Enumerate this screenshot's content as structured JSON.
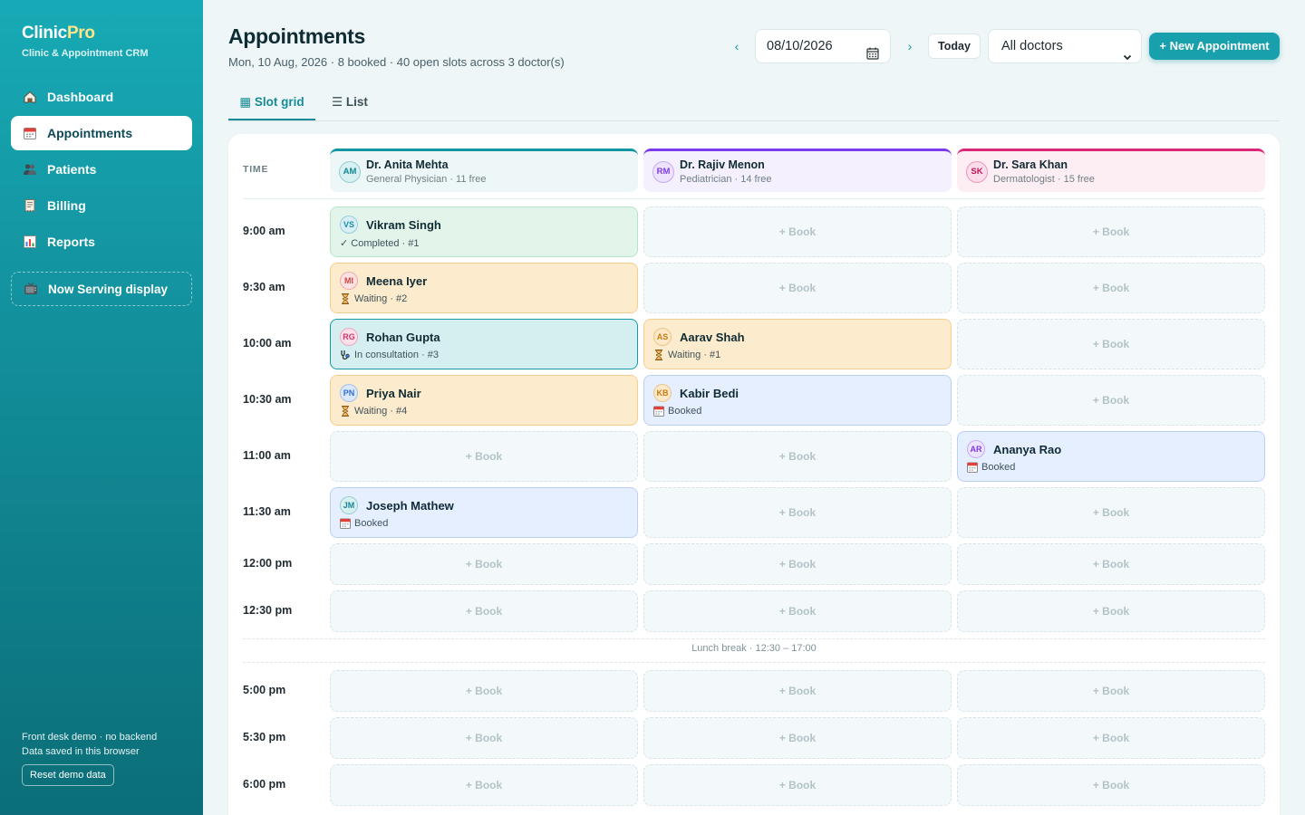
{
  "sidebar": {
    "brand_prefix": "Clinic",
    "brand_suffix": "Pro",
    "brand_sub": "Clinic & Appointment CRM",
    "items": [
      {
        "label": "Dashboard",
        "icon": "home-icon"
      },
      {
        "label": "Appointments",
        "icon": "calendar-icon",
        "active": true
      },
      {
        "label": "Patients",
        "icon": "people-icon"
      },
      {
        "label": "Billing",
        "icon": "receipt-icon"
      },
      {
        "label": "Reports",
        "icon": "bar-chart-icon"
      }
    ],
    "serving": {
      "label": "Now Serving display",
      "icon": "tv-icon"
    },
    "footer_line1": "Front desk demo · no backend",
    "footer_line2": "Data saved in this browser",
    "reset_label": "Reset demo data"
  },
  "header": {
    "title": "Appointments",
    "subtitle": "Mon, 10 Aug, 2026 · 8 booked · 40 open slots across 3 doctor(s)",
    "prev": "‹",
    "next": "›",
    "date_value": "08/10/2026",
    "today_label": "Today",
    "doctor_filter": "All doctors",
    "new_button": "+ New Appointment"
  },
  "tabs": {
    "grid": "▦ Slot grid",
    "list": "☰ List"
  },
  "grid": {
    "time_header": "TIME",
    "doctors": [
      {
        "initials": "AM",
        "name": "Dr. Anita Mehta",
        "sub": "General Physician · 11 free",
        "accent": "#1597a3",
        "bg": "#eef7f8",
        "av_bg": "#d9f0f2",
        "av_fg": "#138794"
      },
      {
        "initials": "RM",
        "name": "Dr. Rajiv Menon",
        "sub": "Pediatrician · 14 free",
        "accent": "#7c3aed",
        "bg": "#f4f0fd",
        "av_bg": "#ede3fd",
        "av_fg": "#7c3aed"
      },
      {
        "initials": "SK",
        "name": "Dr. Sara Khan",
        "sub": "Dermatologist · 15 free",
        "accent": "#db2777",
        "bg": "#fdeef4",
        "av_bg": "#fbdceb",
        "av_fg": "#c2185b"
      }
    ],
    "book_label": "+ Book",
    "rows": [
      {
        "time": "9:00 am",
        "cells": [
          {
            "type": "appt",
            "initials": "VS",
            "name": "Vikram Singh",
            "status": "completed",
            "icon": "check-icon",
            "text": "✓ Completed · #1",
            "av_bg": "#d9eef5",
            "av_fg": "#1b8ca5"
          },
          {
            "type": "empty"
          },
          {
            "type": "empty"
          }
        ]
      },
      {
        "time": "9:30 am",
        "cells": [
          {
            "type": "appt",
            "initials": "MI",
            "name": "Meena Iyer",
            "status": "waiting",
            "icon": "hourglass-icon",
            "text": "Waiting · #2",
            "av_bg": "#fde0e0",
            "av_fg": "#d14545"
          },
          {
            "type": "empty"
          },
          {
            "type": "empty"
          }
        ]
      },
      {
        "time": "10:00 am",
        "cells": [
          {
            "type": "appt",
            "initials": "RG",
            "name": "Rohan Gupta",
            "status": "consult",
            "icon": "stethoscope-icon",
            "text": "In consultation · #3",
            "av_bg": "#fde0ea",
            "av_fg": "#d1346b"
          },
          {
            "type": "appt",
            "initials": "AS",
            "name": "Aarav Shah",
            "status": "waiting",
            "icon": "hourglass-icon",
            "text": "Waiting · #1",
            "av_bg": "#fde8c8",
            "av_fg": "#c77d11"
          },
          {
            "type": "empty"
          }
        ]
      },
      {
        "time": "10:30 am",
        "cells": [
          {
            "type": "appt",
            "initials": "PN",
            "name": "Priya Nair",
            "status": "waiting",
            "icon": "hourglass-icon",
            "text": "Waiting · #4",
            "av_bg": "#dbe8fb",
            "av_fg": "#2f6fd1"
          },
          {
            "type": "appt",
            "initials": "KB",
            "name": "Kabir Bedi",
            "status": "booked",
            "icon": "calendar-icon",
            "text": "Booked",
            "av_bg": "#fde8c8",
            "av_fg": "#c77d11"
          },
          {
            "type": "empty"
          }
        ]
      },
      {
        "time": "11:00 am",
        "cells": [
          {
            "type": "empty"
          },
          {
            "type": "empty"
          },
          {
            "type": "appt",
            "initials": "AR",
            "name": "Ananya Rao",
            "status": "booked",
            "icon": "calendar-icon",
            "text": "Booked",
            "av_bg": "#ece3fd",
            "av_fg": "#7c3aed"
          }
        ]
      },
      {
        "time": "11:30 am",
        "cells": [
          {
            "type": "appt",
            "initials": "JM",
            "name": "Joseph Mathew",
            "status": "booked",
            "icon": "calendar-icon",
            "text": "Booked",
            "av_bg": "#d9f0f2",
            "av_fg": "#138794"
          },
          {
            "type": "empty"
          },
          {
            "type": "empty"
          }
        ]
      },
      {
        "time": "12:00 pm",
        "cells": [
          {
            "type": "empty"
          },
          {
            "type": "empty"
          },
          {
            "type": "empty"
          }
        ]
      },
      {
        "time": "12:30 pm",
        "cells": [
          {
            "type": "empty"
          },
          {
            "type": "empty"
          },
          {
            "type": "empty"
          }
        ]
      },
      {
        "time": "5:00 pm",
        "cells": [
          {
            "type": "empty"
          },
          {
            "type": "empty"
          },
          {
            "type": "empty"
          }
        ]
      },
      {
        "time": "5:30 pm",
        "cells": [
          {
            "type": "empty"
          },
          {
            "type": "empty"
          },
          {
            "type": "empty"
          }
        ]
      },
      {
        "time": "6:00 pm",
        "cells": [
          {
            "type": "empty"
          },
          {
            "type": "empty"
          },
          {
            "type": "empty"
          }
        ]
      }
    ],
    "lunch_label": "Lunch break · 12:30 – 17:00"
  },
  "colors": {
    "accent": "#18a0ad",
    "completed": "#e3f5ea",
    "waiting": "#fdebcd",
    "consult": "#d5eff1",
    "booked": "#e6efff"
  }
}
